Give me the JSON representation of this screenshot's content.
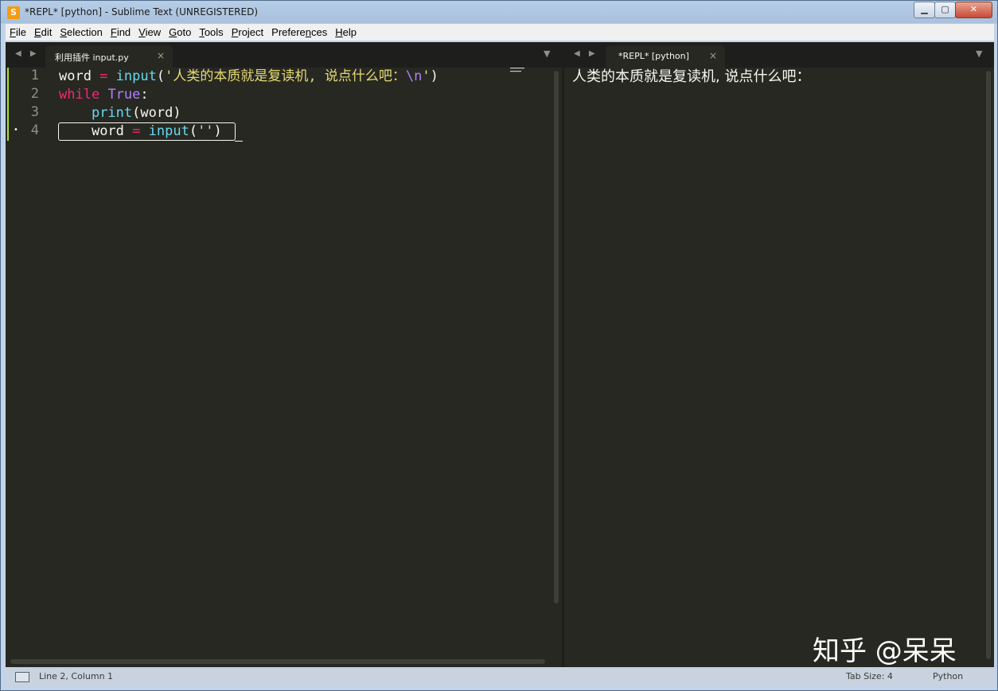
{
  "window": {
    "title": "*REPL* [python] - Sublime Text (UNREGISTERED)",
    "app_icon_letter": "S",
    "minimize_glyph": "▁",
    "maximize_glyph": "▢",
    "close_glyph": "✕"
  },
  "menubar": {
    "items": [
      {
        "accel": "F",
        "rest": "ile"
      },
      {
        "accel": "E",
        "rest": "dit"
      },
      {
        "accel": "S",
        "rest": "election"
      },
      {
        "accel": "F",
        "rest": "ind",
        "accel_pos": "first"
      },
      {
        "accel": "V",
        "rest": "iew"
      },
      {
        "accel": "G",
        "rest": "oto"
      },
      {
        "accel": "T",
        "rest": "ools"
      },
      {
        "accel": "P",
        "rest": "roject"
      },
      {
        "accel": "n",
        "pre": "Prefere",
        "rest": "ces"
      },
      {
        "accel": "H",
        "rest": "elp"
      }
    ]
  },
  "left_pane": {
    "nav_arrows": "◀ ▶",
    "tab_label": "利用插件 input.py",
    "tab_close": "×",
    "dropdown_glyph": "▼",
    "line_numbers": [
      "1",
      "2",
      "3",
      "4"
    ],
    "dirty_marker": "•",
    "code": {
      "l1_var": "word",
      "l1_op": " = ",
      "l1_fn": "input",
      "l1_open": "(",
      "l1_str1": "'人类的本质就是复读机, 说点什么吧：",
      "l1_esc": "\\n",
      "l1_str2": "'",
      "l1_close": ")",
      "l2_kw": "while",
      "l2_sp": " ",
      "l2_const": "True",
      "l2_colon": ":",
      "l3_indent": "    ",
      "l3_fn": "print",
      "l3_rest": "(word)",
      "l4_indent": "    ",
      "l4_var": "word",
      "l4_op": " = ",
      "l4_fn": "input",
      "l4_open": "(",
      "l4_str": "''",
      "l4_close": ")"
    }
  },
  "right_pane": {
    "nav_arrows": "◀ ▶",
    "tab_label": "*REPL* [python]",
    "tab_close": "×",
    "dropdown_glyph": "▼",
    "output": "人类的本质就是复读机, 说点什么吧："
  },
  "watermark": "知乎 @呆呆",
  "statusbar": {
    "position": "Line 2, Column 1",
    "tab_size": "Tab Size: 4",
    "syntax": "Python"
  },
  "colors": {
    "editor_bg": "#272822",
    "keyword": "#f92672",
    "function": "#66d9ef",
    "string": "#e6db74",
    "constant": "#ae81ff",
    "modified": "#a6e22e"
  }
}
